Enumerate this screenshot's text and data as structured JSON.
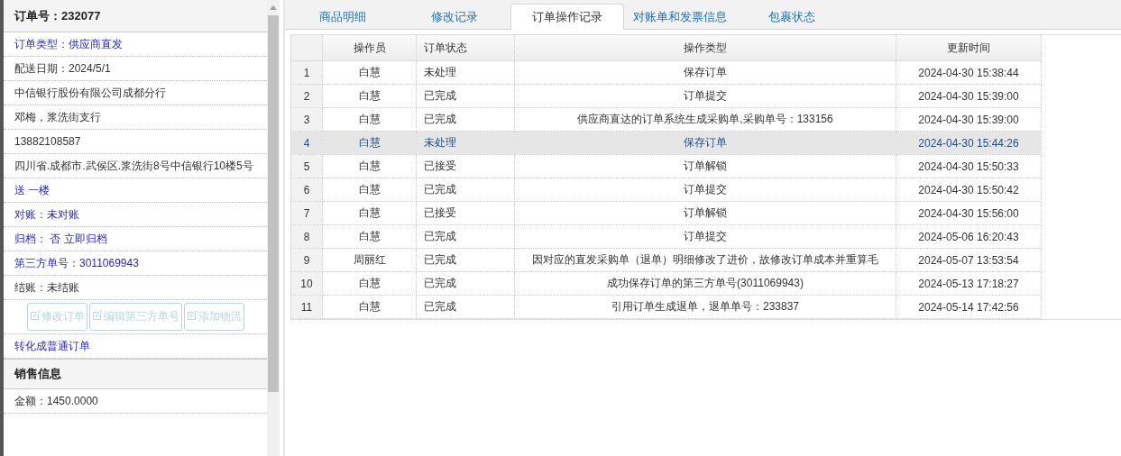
{
  "order_panel": {
    "title": "订单号：232077",
    "items": [
      {
        "kind": "link",
        "text": "订单类型：供应商直发"
      },
      {
        "kind": "text",
        "text": "配送日期：2024/5/1"
      },
      {
        "kind": "text",
        "text": "中信银行股份有限公司成都分行"
      },
      {
        "kind": "text",
        "text": "邓梅，浆洗街支行"
      },
      {
        "kind": "text",
        "text": "13882108587"
      },
      {
        "kind": "text",
        "text": "四川省.成都市.武侯区.浆洗街8号中信银行10楼5号"
      },
      {
        "kind": "link",
        "text": "送 一楼"
      },
      {
        "kind": "link",
        "text": "对账：未对账"
      },
      {
        "kind": "link",
        "text": "归档：  否 立即归档"
      },
      {
        "kind": "link",
        "text": "第三方单号：3011069943"
      },
      {
        "kind": "text",
        "text": "结账：未结账"
      }
    ],
    "buttons": [
      {
        "label": "修改订单",
        "disabled": true
      },
      {
        "label": "编辑第三方单号",
        "disabled": true
      },
      {
        "label": "添加物流",
        "disabled": true
      }
    ],
    "convert_link": "转化成普通订单",
    "sales_title": "销售信息",
    "sales_items": [
      "金额：1450.0000"
    ]
  },
  "tabs": [
    {
      "label": "商品明细",
      "selected": false
    },
    {
      "label": "修改记录",
      "selected": false
    },
    {
      "label": "订单操作记录",
      "selected": true
    },
    {
      "label": "对账单和发票信息",
      "selected": false
    },
    {
      "label": "包裹状态",
      "selected": false
    }
  ],
  "table": {
    "columns": [
      "操作员",
      "订单状态",
      "操作类型",
      "更新时间"
    ],
    "rows": [
      {
        "num": "1",
        "operator": "白慧",
        "status": "未处理",
        "action": "保存订单",
        "time": "2024-04-30 15:38:44",
        "selected": false
      },
      {
        "num": "2",
        "operator": "白慧",
        "status": "已完成",
        "action": "订单提交",
        "time": "2024-04-30 15:39:00",
        "selected": false
      },
      {
        "num": "3",
        "operator": "白慧",
        "status": "已完成",
        "action": "供应商直达的订单系统生成采购单,采购单号：133156",
        "time": "2024-04-30 15:39:00",
        "selected": false
      },
      {
        "num": "4",
        "operator": "白慧",
        "status": "未处理",
        "action": "保存订单",
        "time": "2024-04-30 15:44:26",
        "selected": true
      },
      {
        "num": "5",
        "operator": "白慧",
        "status": "已接受",
        "action": "订单解锁",
        "time": "2024-04-30 15:50:33",
        "selected": false
      },
      {
        "num": "6",
        "operator": "白慧",
        "status": "已完成",
        "action": "订单提交",
        "time": "2024-04-30 15:50:42",
        "selected": false
      },
      {
        "num": "7",
        "operator": "白慧",
        "status": "已接受",
        "action": "订单解锁",
        "time": "2024-04-30 15:56:00",
        "selected": false
      },
      {
        "num": "8",
        "operator": "白慧",
        "status": "已完成",
        "action": "订单提交",
        "time": "2024-05-06 16:20:43",
        "selected": false
      },
      {
        "num": "9",
        "operator": "周丽红",
        "status": "已完成",
        "action": "因对应的直发采购单（退单）明细修改了进价，故修改订单成本并重算毛",
        "time": "2024-05-07 13:53:54",
        "selected": false
      },
      {
        "num": "10",
        "operator": "白慧",
        "status": "已完成",
        "action": "成功保存订单的第三方单号(3011069943)",
        "time": "2024-05-13 17:18:27",
        "selected": false
      },
      {
        "num": "11",
        "operator": "白慧",
        "status": "已完成",
        "action": "引用订单生成退单，退单单号：233837",
        "time": "2024-05-14 17:42:56",
        "selected": false
      }
    ]
  }
}
